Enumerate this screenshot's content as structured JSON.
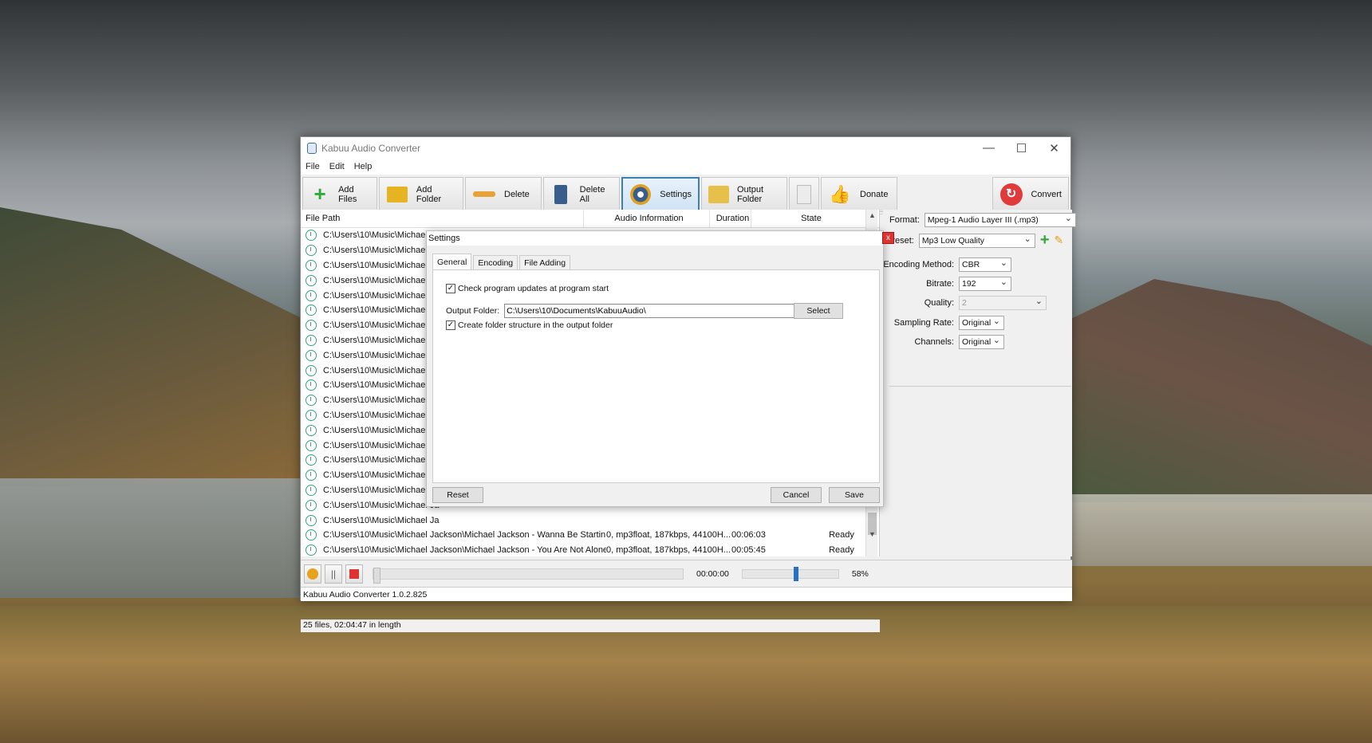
{
  "window": {
    "title": "Kabuu Audio Converter",
    "ctrl_min": "—",
    "ctrl_max": "☐",
    "ctrl_close": "✕"
  },
  "menu": [
    "File",
    "Edit",
    "Help"
  ],
  "toolbar": [
    {
      "label": "Add Files",
      "icon": "plus-icon",
      "color": "#2fa83a"
    },
    {
      "label": "Add Folder",
      "icon": "folder-icon",
      "color": "#e6b422"
    },
    {
      "label": "Delete",
      "icon": "minus-icon",
      "color": "#e8a23a"
    },
    {
      "label": "Delete All",
      "icon": "trash-icon",
      "color": "#3a5e8c"
    },
    {
      "label": "Settings",
      "icon": "gear-disc-icon",
      "color": "#e0a020"
    },
    {
      "label": "Output Folder",
      "icon": "open-folder-icon",
      "color": "#e6c04a"
    },
    {
      "label": "",
      "icon": "document-icon",
      "color": "#ddd"
    },
    {
      "label": "Donate",
      "icon": "thumbs-up-icon",
      "color": "#e8a23a"
    },
    {
      "label": "Convert",
      "icon": "convert-icon",
      "color": "#e03a3a"
    }
  ],
  "filelist": {
    "headers": {
      "path": "File Path",
      "audio": "Audio Information",
      "duration": "Duration",
      "state": "State"
    },
    "path_prefix": "C:\\Users\\10\\Music\\Michael Ja",
    "rows": [
      {
        "path": "C:\\Users\\10\\Music\\Michael Jackson\\Michael Jackson - Wanna Be Startin S...",
        "audio": "0, mp3float, 187kbps, 44100H...",
        "duration": "00:06:03",
        "state": "Ready"
      },
      {
        "path": "C:\\Users\\10\\Music\\Michael Jackson\\Michael Jackson - You Are Not Alone....",
        "audio": "0, mp3float, 187kbps, 44100H...",
        "duration": "00:05:45",
        "state": "Ready"
      }
    ],
    "summary": "25 files, 02:04:47 in length"
  },
  "right": {
    "format_label": "Format:",
    "format_value": "Mpeg-1 Audio Layer III (.mp3)",
    "preset_label": "Preset:",
    "preset_value": "Mp3 Low Quality",
    "encoding_label": "Encoding Method:",
    "encoding_value": "CBR",
    "bitrate_label": "Bitrate:",
    "bitrate_value": "192",
    "quality_label": "Quality:",
    "quality_value": "2",
    "sampling_label": "Sampling Rate:",
    "sampling_value": "Original",
    "channels_label": "Channels:",
    "channels_value": "Original"
  },
  "player": {
    "time": "00:00:00",
    "volume_label": "58%",
    "volume": 0.58
  },
  "statusbar": "Kabuu Audio Converter 1.0.2.825",
  "settings": {
    "title": "Settings",
    "close": "x",
    "tabs": [
      "General",
      "Encoding",
      "File Adding"
    ],
    "check_updates": "Check program updates at program start",
    "output_label": "Output Folder:",
    "output_value": "C:\\Users\\10\\Documents\\KabuuAudio\\",
    "select": "Select",
    "create_structure": "Create folder structure in the output folder",
    "reset": "Reset",
    "cancel": "Cancel",
    "save": "Save",
    "checkmark": "✓"
  }
}
